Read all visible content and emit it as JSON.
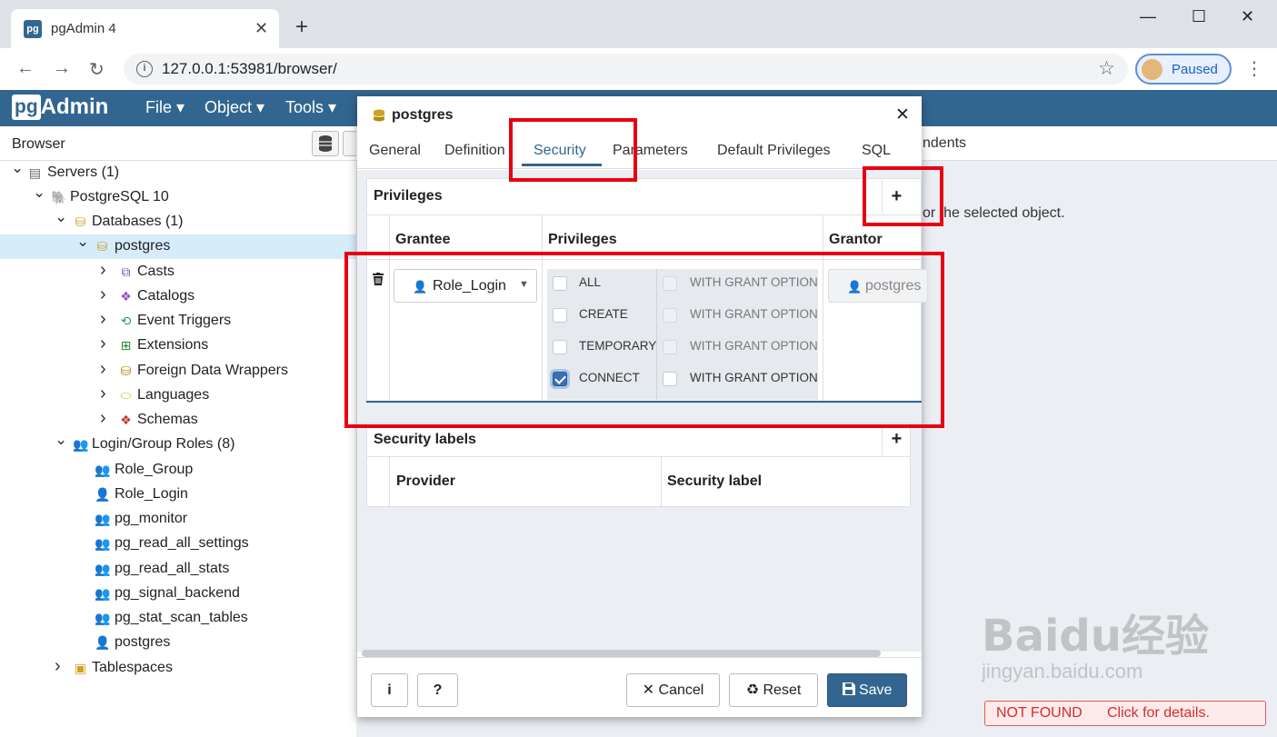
{
  "browser": {
    "tab_title": "pgAdmin 4",
    "url": "127.0.0.1:53981/browser/",
    "profile_label": "Paused"
  },
  "app": {
    "logo_pg": "pg",
    "logo_admin": "Admin",
    "menus": [
      "File",
      "Object",
      "Tools"
    ],
    "browser_title": "Browser"
  },
  "tree": [
    {
      "label": "Servers (1)",
      "icon": "servers-icon"
    },
    {
      "label": "PostgreSQL 10",
      "icon": "elephant-icon"
    },
    {
      "label": "Databases (1)",
      "icon": "databases-icon"
    },
    {
      "label": "postgres",
      "icon": "database-icon"
    },
    {
      "label": "Casts",
      "icon": "cast-icon"
    },
    {
      "label": "Catalogs",
      "icon": "catalog-icon"
    },
    {
      "label": "Event Triggers",
      "icon": "event-trigger-icon"
    },
    {
      "label": "Extensions",
      "icon": "extension-icon"
    },
    {
      "label": "Foreign Data Wrappers",
      "icon": "fdw-icon"
    },
    {
      "label": "Languages",
      "icon": "language-icon"
    },
    {
      "label": "Schemas",
      "icon": "schema-icon"
    },
    {
      "label": "Login/Group Roles (8)",
      "icon": "roles-icon"
    },
    {
      "label": "Role_Group",
      "icon": "group-role-icon"
    },
    {
      "label": "Role_Login",
      "icon": "login-role-icon"
    },
    {
      "label": "pg_monitor",
      "icon": "group-role-icon"
    },
    {
      "label": "pg_read_all_settings",
      "icon": "group-role-icon"
    },
    {
      "label": "pg_read_all_stats",
      "icon": "group-role-icon"
    },
    {
      "label": "pg_signal_backend",
      "icon": "group-role-icon"
    },
    {
      "label": "pg_stat_scan_tables",
      "icon": "group-role-icon"
    },
    {
      "label": "postgres",
      "icon": "login-role-icon"
    },
    {
      "label": "Tablespaces",
      "icon": "tablespace-icon"
    }
  ],
  "right_panel": {
    "tab_partial": "ndents",
    "message_partial": "or the selected object."
  },
  "dialog": {
    "title": "postgres",
    "tabs": [
      "General",
      "Definition",
      "Security",
      "Parameters",
      "Default Privileges",
      "SQL"
    ],
    "active_tab": "Security",
    "privileges": {
      "title": "Privileges",
      "columns": [
        "Grantee",
        "Privileges",
        "Grantor"
      ],
      "row": {
        "grantee": "Role_Login",
        "grantor": "postgres",
        "items": [
          {
            "name": "ALL",
            "checked": false,
            "grant_option": "WITH GRANT OPTION"
          },
          {
            "name": "CREATE",
            "checked": false,
            "grant_option": "WITH GRANT OPTION"
          },
          {
            "name": "TEMPORARY",
            "checked": false,
            "grant_option": "WITH GRANT OPTION"
          },
          {
            "name": "CONNECT",
            "checked": true,
            "grant_option": "WITH GRANT OPTION"
          }
        ]
      }
    },
    "security_labels": {
      "title": "Security labels",
      "columns": [
        "Provider",
        "Security label"
      ]
    },
    "footer": {
      "info": "i",
      "help": "?",
      "cancel": "Cancel",
      "reset": "Reset",
      "save": "Save"
    }
  },
  "watermark": {
    "main": "Baidu经验",
    "sub": "jingyan.baidu.com"
  },
  "error_bar": {
    "status": "NOT FOUND",
    "hint": "Click for details."
  },
  "colors": {
    "app_bar": "#326690",
    "selected_row": "#d7ecfb",
    "highlight": "#e60012"
  }
}
